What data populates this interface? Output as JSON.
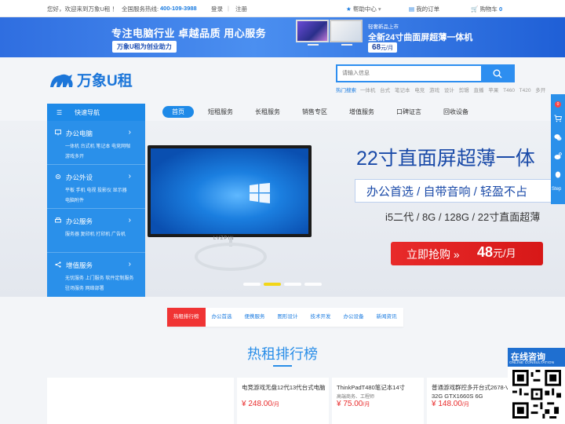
{
  "topbar": {
    "welcome": "您好，欢迎来到万象U租 ！",
    "hotline_label": "全国服务热线:",
    "hotline": "400-109-3988",
    "login": "登录",
    "register": "注册",
    "help": "帮助中心",
    "orders": "我的订单",
    "cart": "购物车",
    "cart_count": "0"
  },
  "promo": {
    "slogan": "专注电脑行业 卓越品质 用心服务",
    "pill": "万象U租为创业助力",
    "small": "轻奢新品上市",
    "big": "全新24寸曲面屏超薄一体机",
    "price": "68",
    "unit": "元/月"
  },
  "logo": {
    "text": "万象U租"
  },
  "search": {
    "placeholder": "请输入信息",
    "hot_label": "热门搜索",
    "hot_words": [
      "一体机",
      "台式",
      "笔记本",
      "电竞",
      "游戏",
      "设计",
      "剪辑",
      "直播",
      "苹果",
      "T460",
      "T420",
      "多开"
    ]
  },
  "nav": {
    "quick": "快速导航",
    "items": [
      "首页",
      "短租服务",
      "长租服务",
      "销售专区",
      "增值服务",
      "口碑证言",
      "回收设备"
    ]
  },
  "categories": [
    {
      "title": "办公电脑",
      "line1": "一体机 台式机 笔记本 电竞网咖",
      "line2": "游戏多开"
    },
    {
      "title": "办公外设",
      "line1": "平板 手机 电视 投影仪 显示器",
      "line2": "电脑附件"
    },
    {
      "title": "办公服务",
      "line1": "服务器 复印机 打印机 广告机",
      "line2": ""
    },
    {
      "title": "增值服务",
      "line1": "无忧服务 上门服务 软件定制服务",
      "line2": "驻场服务 网络部署"
    }
  ],
  "hero": {
    "brand": "LVZPIN",
    "headline": "22寸直面屏超薄一体",
    "bar": "办公首选 / 自带音响 / 轻盈不占",
    "spec": "i5二代 / 8G / 128G / 22寸直面超薄",
    "cta_text": "立即抢购 »",
    "cta_price": "48",
    "cta_unit": "元/月"
  },
  "side": {
    "badge": "0",
    "step": "Step"
  },
  "tabs": [
    "热租排行榜",
    "办公首选",
    "便携服务",
    "图形设计",
    "技术开发",
    "办公设备",
    "新闻资讯"
  ],
  "section": {
    "title": "热租排行榜"
  },
  "products": [
    {
      "name": "电竞游戏无盘12代13代台式电脑",
      "sub": "",
      "price": "¥ 248.00",
      "unit": "/月"
    },
    {
      "name": "ThinkPadT480笔记本14寸",
      "sub": "高端商务、工程师",
      "price": "¥ 75.00",
      "unit": "/月"
    },
    {
      "name": "普通游戏群控多开台式2678-V 32G GTX1660S 6G",
      "sub": "",
      "price": "¥ 148.00",
      "unit": "/月"
    }
  ],
  "consult": {
    "title": "在线咨询",
    "sub": "ONLINE CONSULTATION"
  },
  "colors": {
    "brand_blue": "#1e8ae8",
    "accent_red": "#e82a2a",
    "highlight_yellow": "#f3d400"
  }
}
